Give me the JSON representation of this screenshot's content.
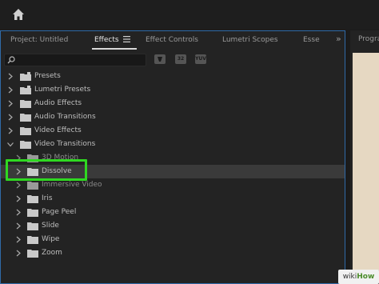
{
  "tabs": [
    {
      "label": "Project: Untitled"
    },
    {
      "label": "Effects"
    },
    {
      "label": "Effect Controls"
    },
    {
      "label": "Lumetri Scopes"
    },
    {
      "label": "Esse"
    }
  ],
  "right_panel_title": "Prograi",
  "filter_buttons": [
    "32",
    "YUV"
  ],
  "tree": [
    {
      "label": "Presets",
      "expanded": false,
      "level": 0
    },
    {
      "label": "Lumetri Presets",
      "expanded": false,
      "level": 0
    },
    {
      "label": "Audio Effects",
      "expanded": false,
      "level": 0
    },
    {
      "label": "Audio Transitions",
      "expanded": false,
      "level": 0
    },
    {
      "label": "Video Effects",
      "expanded": false,
      "level": 0
    },
    {
      "label": "Video Transitions",
      "expanded": true,
      "level": 0
    },
    {
      "label": "3D Motion",
      "expanded": false,
      "level": 1
    },
    {
      "label": "Dissolve",
      "expanded": false,
      "level": 1,
      "selected": true
    },
    {
      "label": "Immersive Video",
      "expanded": false,
      "level": 1
    },
    {
      "label": "Iris",
      "expanded": false,
      "level": 1
    },
    {
      "label": "Page Peel",
      "expanded": false,
      "level": 1
    },
    {
      "label": "Slide",
      "expanded": false,
      "level": 1
    },
    {
      "label": "Wipe",
      "expanded": false,
      "level": 1
    },
    {
      "label": "Zoom",
      "expanded": false,
      "level": 1
    }
  ],
  "watermark": {
    "part1": "wiki",
    "part2": "How"
  },
  "colors": {
    "highlight": "#2fd821",
    "panel_border": "#2f6aa8",
    "selection": "#3a3a3a"
  }
}
